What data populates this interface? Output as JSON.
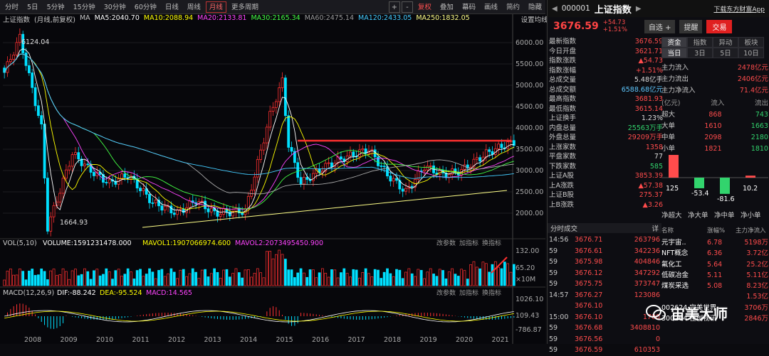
{
  "toolbar": {
    "periods": [
      "分时",
      "5日",
      "5分钟",
      "15分钟",
      "30分钟",
      "60分钟",
      "日线",
      "周线",
      "月线",
      "更多周期"
    ],
    "active_period": "月线",
    "controls": [
      "+",
      "-",
      "复权",
      "叠加",
      "幕码",
      "画线",
      "简约",
      "隐藏"
    ],
    "adjust_label": "复权"
  },
  "main_chart": {
    "title": "上证指数",
    "subtitle": "(月线,前复权)",
    "ma": [
      {
        "label": "MA",
        "value": ""
      },
      {
        "label": "MA5:2040.70",
        "color": "#ffffff"
      },
      {
        "label": "MA10:2088.94",
        "color": "#ffff00"
      },
      {
        "label": "MA20:2133.81",
        "color": "#ff44ff"
      },
      {
        "label": "MA30:2165.34",
        "color": "#44ff44"
      },
      {
        "label": "MA60:2475.14",
        "color": "#999999"
      },
      {
        "label": "MA120:2433.05",
        "color": "#44ccff"
      },
      {
        "label": "MA250:1832.05",
        "color": "#ffff88"
      }
    ],
    "setting_label": "设置均线",
    "high_label": "6124.04",
    "low_label": "1664.93",
    "yaxis": [
      "6000.00",
      "5500.00",
      "5000.00",
      "4500.00",
      "4000.00",
      "3500.00",
      "3000.00",
      "2500.00",
      "2000.00"
    ]
  },
  "vol_panel": {
    "label": "VOL(5,10)",
    "vol": "VOLUME:1591231478.000",
    "mavol1": "MAVOL1:1907066974.600",
    "mavol2": "MAVOL2:2073495450.900",
    "links": [
      "改参数",
      "加指标",
      "换指标"
    ],
    "yaxis": [
      "132.00",
      "65.20",
      "×10M"
    ]
  },
  "macd_panel": {
    "label": "MACD(12,26,9)",
    "dif": "DIF:-88.242",
    "dea": "DEA:-95.524",
    "macd": "MACD:14.565",
    "yaxis": [
      "1026.10",
      "109.43",
      "-786.87"
    ]
  },
  "xaxis": [
    "2008",
    "2009",
    "2010",
    "2011",
    "2012",
    "2013",
    "2014",
    "2015",
    "2016",
    "2017",
    "2018",
    "2019",
    "2020",
    "2021"
  ],
  "chart_data": {
    "type": "candlestick",
    "series": [
      {
        "name": "上证指数 月线"
      }
    ],
    "ylim": [
      1600,
      6200
    ],
    "annotations": [
      "6124.04",
      "1664.93"
    ],
    "x": [
      "2008",
      "2009",
      "2010",
      "2011",
      "2012",
      "2013",
      "2014",
      "2015",
      "2016",
      "2017",
      "2018",
      "2019",
      "2020",
      "2021"
    ],
    "approx_close": [
      1820,
      3277,
      2808,
      2199,
      2269,
      2116,
      3235,
      3539,
      3104,
      3307,
      2494,
      3050,
      3473,
      3676
    ]
  },
  "quote": {
    "code": "000001",
    "name": "上证指数",
    "download": "下载东方财富App",
    "price": "3676.59",
    "change": "+54.73",
    "pct": "+1.51%",
    "btn_self": "自选 +",
    "btn_remind": "提醒",
    "btn_trade": "交易"
  },
  "stats": [
    [
      "最新指数",
      "3676.59",
      "v"
    ],
    [
      "今日开盘",
      "3621.71",
      "v"
    ],
    [
      "指数涨跌",
      "▲54.73",
      "v"
    ],
    [
      "指数涨幅",
      "+1.51%",
      "v"
    ],
    [
      "总成交量",
      "5.48亿手",
      "w"
    ],
    [
      "总成交额",
      "6588.68亿元",
      "c"
    ],
    [
      "最高指数",
      "3681.93",
      "v"
    ],
    [
      "最低指数",
      "3615.14",
      "v"
    ],
    [
      "上证换手",
      "1.23%",
      "w"
    ],
    [
      "内盘总量",
      "25563万手",
      "g"
    ],
    [
      "外盘总量",
      "29209万手",
      "v"
    ],
    [
      "上涨家数",
      "1358",
      "v"
    ],
    [
      "平盘家数",
      "77",
      "w"
    ],
    [
      "下跌家数",
      "585",
      "g"
    ],
    [
      "上证A股",
      "3853.39",
      "v"
    ],
    [
      "上A涨跌",
      "▲57.38",
      "v"
    ],
    [
      "上证B股",
      "275.37",
      "v"
    ],
    [
      "上B涨跌",
      "▲3.26",
      "v"
    ]
  ],
  "flow_tabs": [
    "资金",
    "指数",
    "异动",
    "板块"
  ],
  "flow_tabs2": [
    "当日",
    "3日",
    "5日",
    "10日"
  ],
  "flow": [
    [
      "主力流入",
      "2478亿元"
    ],
    [
      "主力流出",
      "2406亿元"
    ],
    [
      "主力净流入",
      "71.4亿元"
    ]
  ],
  "flow_head": [
    "(亿元)",
    "流入",
    "流出"
  ],
  "flow_size": [
    [
      "超大",
      "868",
      "743"
    ],
    [
      "大单",
      "1610",
      "1663"
    ],
    [
      "中单",
      "2098",
      "2180"
    ],
    [
      "小单",
      "1821",
      "1810"
    ]
  ],
  "net_bars": [
    {
      "label": "净超大",
      "value": 125
    },
    {
      "label": "净大单",
      "value": -53.4
    },
    {
      "label": "净中单",
      "value": -81.6
    },
    {
      "label": "净小单",
      "value": 10.2
    }
  ],
  "ticks_title": "分时成交",
  "ticks_btn": "详",
  "ticks": [
    [
      "14:56",
      "3676.71",
      "263796"
    ],
    [
      "59",
      "3676.61",
      "342236"
    ],
    [
      "59",
      "3675.98",
      "404846"
    ],
    [
      "59",
      "3676.12",
      "347292"
    ],
    [
      "59",
      "3675.75",
      "373747"
    ],
    [
      "14:57",
      "3676.27",
      "123086"
    ],
    [
      "",
      "3676.10",
      ""
    ],
    [
      "15:00",
      "3676.10",
      "1700"
    ],
    [
      "59",
      "3676.68",
      "3408810"
    ],
    [
      "59",
      "3676.56",
      "0"
    ],
    [
      "59",
      "3676.59",
      "610353"
    ]
  ],
  "plate_head": [
    "名称",
    "涨幅%",
    "主力净流入"
  ],
  "plates": [
    [
      "元宇宙..",
      "6.78",
      "5198万"
    ],
    [
      "NFT概念",
      "6.36",
      "3.72亿"
    ],
    [
      "氟化工",
      "5.64",
      "25.2亿"
    ],
    [
      "低碳冶金",
      "5.11",
      "5.11亿"
    ],
    [
      "煤炭采选",
      "5.08",
      "8.23亿"
    ],
    [
      "",
      "",
      "1.53亿"
    ],
    [
      "002624 完美世界",
      "",
      "3706万"
    ],
    [
      "300264 佳创视讯",
      "",
      "2846万"
    ]
  ],
  "watermark": "宙美大师"
}
